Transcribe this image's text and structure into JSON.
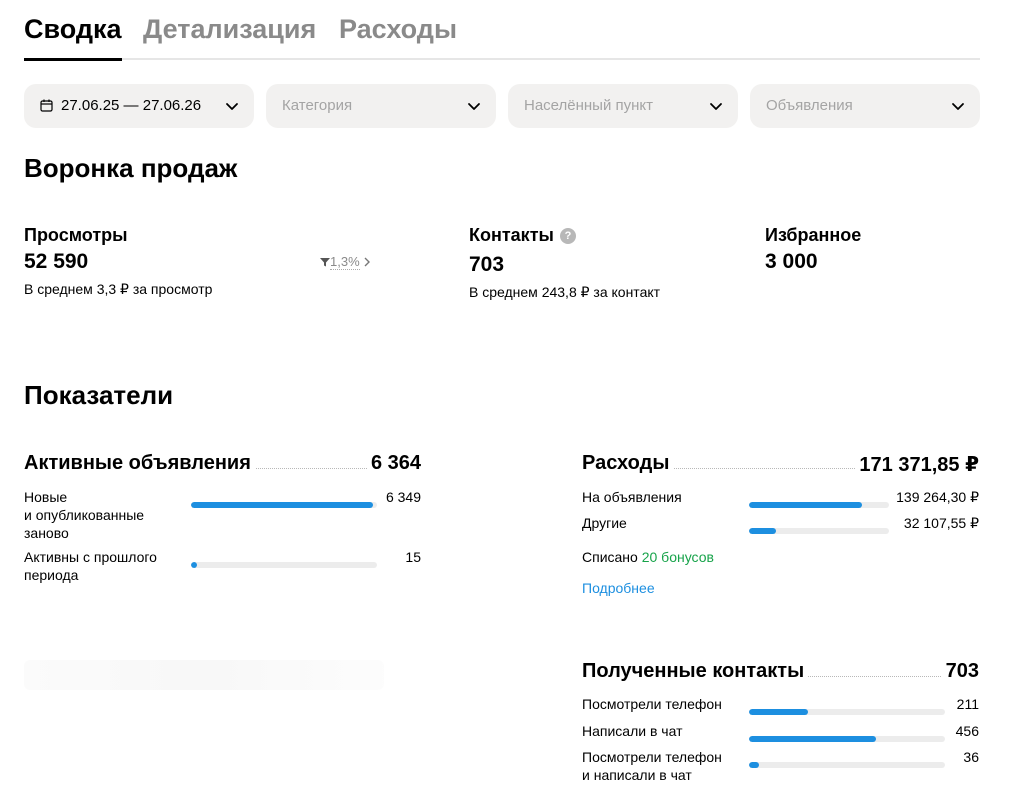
{
  "tabs": [
    {
      "label": "Сводка",
      "active": true
    },
    {
      "label": "Детализация",
      "active": false
    },
    {
      "label": "Расходы",
      "active": false
    }
  ],
  "filters": {
    "date": "27.06.25 — 27.06.26",
    "category_placeholder": "Категория",
    "city_placeholder": "Населённый пункт",
    "ads": "Объявления"
  },
  "funnel": {
    "title": "Воронка продаж",
    "views": {
      "label": "Просмотры",
      "value": "52 590",
      "sub": "В среднем 3,3 ₽ за просмотр",
      "conversion": "1,3%"
    },
    "contacts": {
      "label": "Контакты",
      "value": "703",
      "sub": "В среднем 243,8 ₽ за контакт",
      "help": "?"
    },
    "favorites": {
      "label": "Избранное",
      "value": "3 000"
    }
  },
  "indicators": {
    "title": "Показатели",
    "active_ads": {
      "title": "Активные объявления",
      "total": "6 364",
      "rows": [
        {
          "label_lines": [
            "Новые",
            "и опубликованные",
            "заново"
          ],
          "value": "6 349",
          "fraction": 0.98
        },
        {
          "label_lines": [
            "Активны с прошлого",
            "периода"
          ],
          "value": "15",
          "fraction": 0.03
        }
      ]
    },
    "expenses": {
      "title": "Расходы",
      "total": "171 371,85 ₽",
      "rows": [
        {
          "label": "На объявления",
          "value": "139 264,30 ₽",
          "fraction": 0.81
        },
        {
          "label": "Другие",
          "value": "32 107,55 ₽",
          "fraction": 0.19
        }
      ],
      "written_off_prefix": "Списано",
      "bonuses": "20 бонусов",
      "more_link": "Подробнее"
    },
    "contacts": {
      "title": "Полученные контакты",
      "total": "703",
      "rows": [
        {
          "label_lines": [
            "Посмотрели телефон"
          ],
          "value": "211",
          "fraction": 0.3
        },
        {
          "label_lines": [
            "Написали в чат"
          ],
          "value": "456",
          "fraction": 0.65
        },
        {
          "label_lines": [
            "Посмотрели телефон",
            "и написали в чат"
          ],
          "value": "36",
          "fraction": 0.05
        }
      ]
    }
  },
  "colors": {
    "accent": "#1d8fe0",
    "bonus": "#17a34a",
    "filter_bg": "#f2f1f0"
  }
}
